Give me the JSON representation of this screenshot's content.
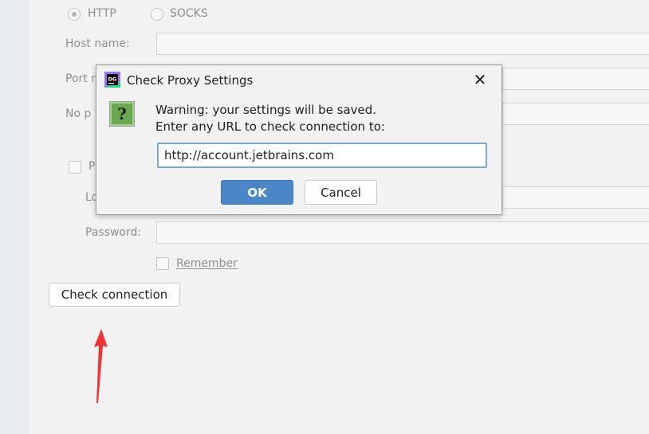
{
  "proxy_type": {
    "http_label": "HTTP",
    "socks_label": "SOCKS",
    "selected": "HTTP"
  },
  "fields": {
    "host_name_label": "Host name:",
    "port_label_partial": "Port n",
    "no_proxy_label_partial": "No p",
    "proxy_auth_label_partial": "P",
    "login_label_partial": "Lo",
    "password_label": "Password:",
    "remember_label": "Remember"
  },
  "check_connection_label": "Check connection",
  "dialog": {
    "title": "Check Proxy Settings",
    "app_icon_text": "DG",
    "message_line1": "Warning: your settings will be saved.",
    "message_line2": "Enter any URL to check connection to:",
    "url_value": "http://account.jetbrains.com",
    "ok_label": "OK",
    "cancel_label": "Cancel",
    "question_glyph": "?"
  },
  "colors": {
    "annotation_arrow": "#ee3333",
    "ok_button": "#4a86c8",
    "focus_border": "#7aa7d8"
  }
}
